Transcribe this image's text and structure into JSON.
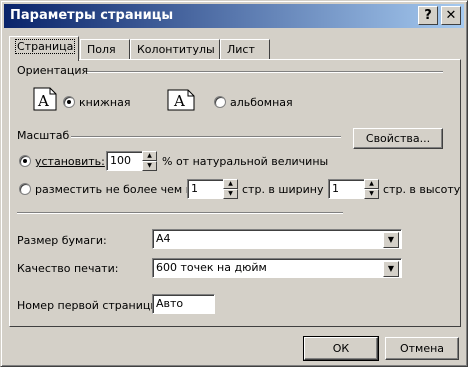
{
  "window": {
    "title": "Параметры страницы",
    "help_glyph": "?",
    "close_glyph": "✕"
  },
  "tabs": [
    {
      "label": "Страница",
      "active": true
    },
    {
      "label": "Поля"
    },
    {
      "label": "Колонтитулы"
    },
    {
      "label": "Лист"
    }
  ],
  "orientation": {
    "group_label": "Ориентация",
    "portrait_label": "книжная",
    "landscape_label": "альбомная",
    "icon_letter": "A",
    "selected": "portrait"
  },
  "scale": {
    "group_label": "Масштаб",
    "properties_button": "Свойства...",
    "adjust_label": "установить:",
    "adjust_value": "100",
    "adjust_suffix": "% от натуральной величины",
    "fit_label": "разместить не более чем на:",
    "fit_wide_value": "1",
    "fit_wide_label": "стр. в ширину и",
    "fit_tall_value": "1",
    "fit_tall_label": "стр. в высоту",
    "selected": "adjust"
  },
  "paper_size": {
    "label": "Размер бумаги:",
    "value": "A4"
  },
  "print_quality": {
    "label": "Качество печати:",
    "value": "600 точек на дюйм"
  },
  "first_page": {
    "label": "Номер первой страницы:",
    "value": "Авто"
  },
  "buttons": {
    "ok": "ОК",
    "cancel": "Отмена"
  },
  "colors": {
    "face": "#d4d0c8",
    "title_start": "#0a246a",
    "title_end": "#a6caf0"
  }
}
